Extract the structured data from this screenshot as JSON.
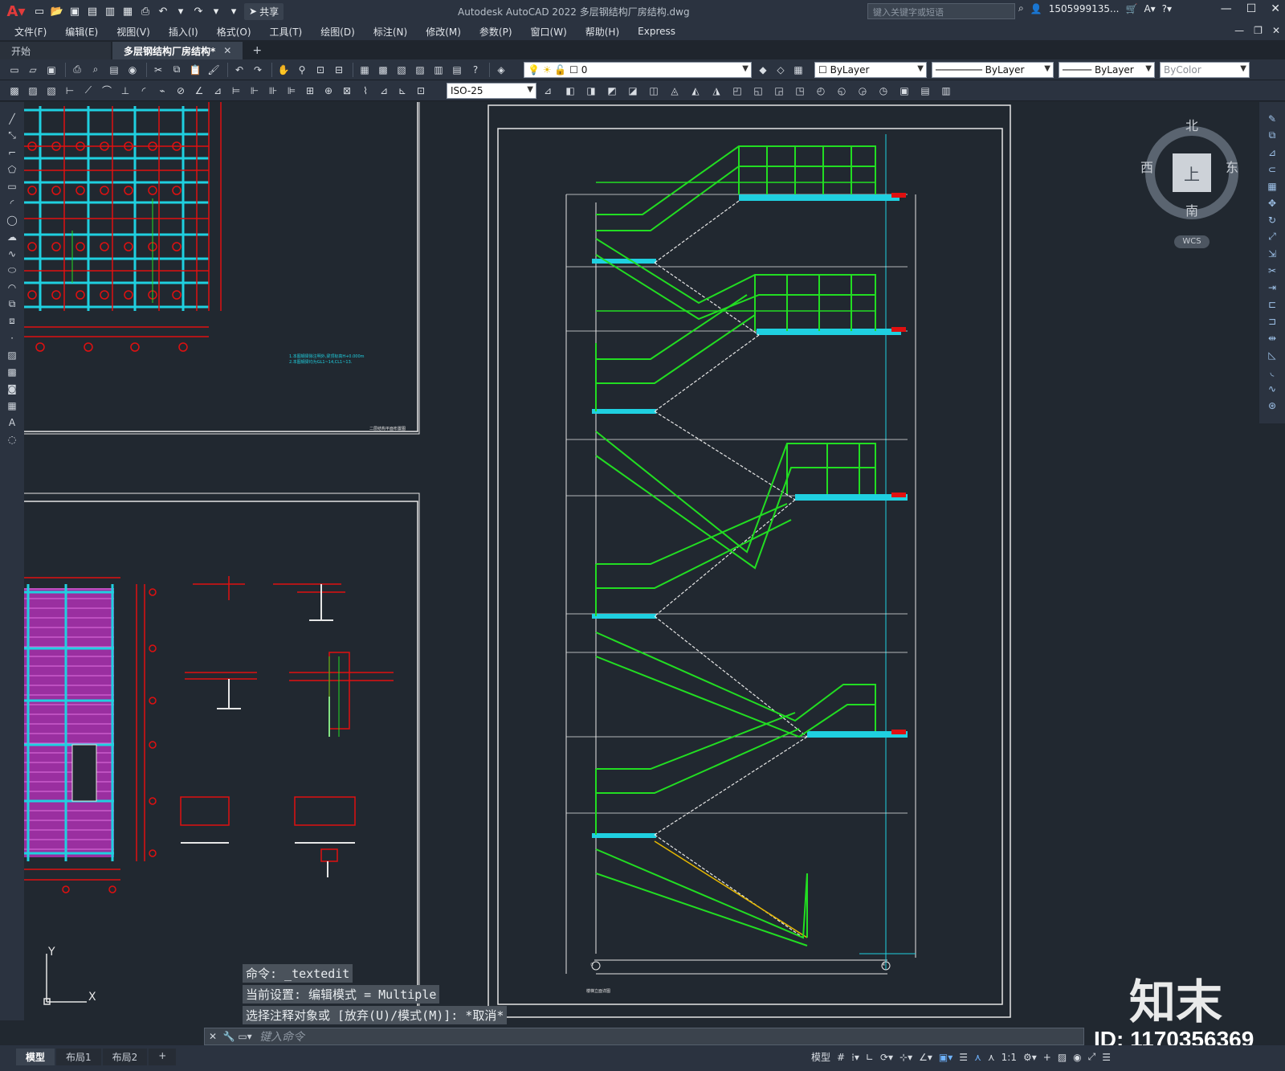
{
  "titlebar": {
    "app_title": "Autodesk AutoCAD 2022    多层钢结构厂房结构.dwg",
    "share": "共享",
    "search_placeholder": "键入关键字或短语",
    "user": "1505999135...",
    "icons": [
      "new-icon",
      "open-icon",
      "save-icon",
      "saveas-icon",
      "plot-icon",
      "undo-icon",
      "redo-icon"
    ]
  },
  "menu": [
    "文件(F)",
    "编辑(E)",
    "视图(V)",
    "插入(I)",
    "格式(O)",
    "工具(T)",
    "绘图(D)",
    "标注(N)",
    "修改(M)",
    "参数(P)",
    "窗口(W)",
    "帮助(H)",
    "Express"
  ],
  "tabs": [
    {
      "label": "开始",
      "active": false
    },
    {
      "label": "多层钢结构厂房结构*",
      "active": true
    }
  ],
  "toolbar": {
    "layer": "0",
    "color": "ByLayer",
    "linetype": "ByLayer",
    "lineweight": "ByLayer",
    "plotstyle": "ByColor",
    "dimstyle": "ISO-25"
  },
  "viewcube": {
    "north": "北",
    "south": "南",
    "east": "东",
    "west": "西",
    "face": "上",
    "wcs": "WCS"
  },
  "command": {
    "history": [
      "命令: _textedit",
      "当前设置: 编辑模式 = Multiple",
      "选择注释对象或 [放弃(U)/模式(M)]: *取消*"
    ],
    "placeholder": "键入命令"
  },
  "layouts": [
    {
      "label": "模型",
      "active": true
    },
    {
      "label": "布局1",
      "active": false
    },
    {
      "label": "布局2",
      "active": false
    }
  ],
  "status": {
    "model": "模型",
    "scale": "1:1"
  },
  "watermark": {
    "logo": "知末",
    "id": "ID: 1170356369"
  },
  "colors": {
    "canvas": "#212830",
    "green": "#22dd22",
    "cyan": "#1fd0e0",
    "red": "#e01010",
    "magenta": "#d040d0",
    "white": "#e6e6e6"
  }
}
